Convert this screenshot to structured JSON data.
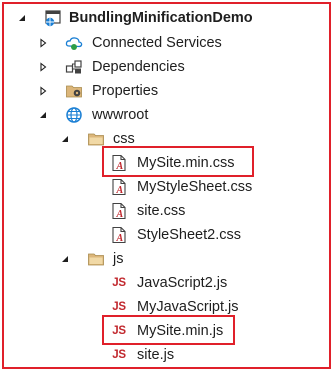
{
  "project": {
    "name": "BundlingMinificationDemo",
    "icon": "web-project-icon"
  },
  "tree": {
    "connected_services": {
      "label": "Connected Services",
      "icon": "cloud-services-icon"
    },
    "dependencies": {
      "label": "Dependencies",
      "icon": "dependencies-icon"
    },
    "properties": {
      "label": "Properties",
      "icon": "properties-folder-icon"
    },
    "wwwroot": {
      "label": "wwwroot",
      "icon": "globe-icon"
    },
    "css_folder": {
      "label": "css",
      "files": [
        {
          "label": "MySite.min.css",
          "icon": "css-file-icon"
        },
        {
          "label": "MyStyleSheet.css",
          "icon": "css-file-icon"
        },
        {
          "label": "site.css",
          "icon": "css-file-icon"
        },
        {
          "label": "StyleSheet2.css",
          "icon": "css-file-icon"
        }
      ]
    },
    "js_folder": {
      "label": "js",
      "icon_text": "JS",
      "files": [
        {
          "label": "JavaScript2.js",
          "icon": "js-file-icon"
        },
        {
          "label": "MyJavaScript.js",
          "icon": "js-file-icon"
        },
        {
          "label": "MySite.min.js",
          "icon": "js-file-icon"
        },
        {
          "label": "site.js",
          "icon": "js-file-icon"
        }
      ]
    }
  },
  "colors": {
    "highlight": "#e0202a",
    "js": "#c1272d",
    "folder": "#dcb67a"
  }
}
